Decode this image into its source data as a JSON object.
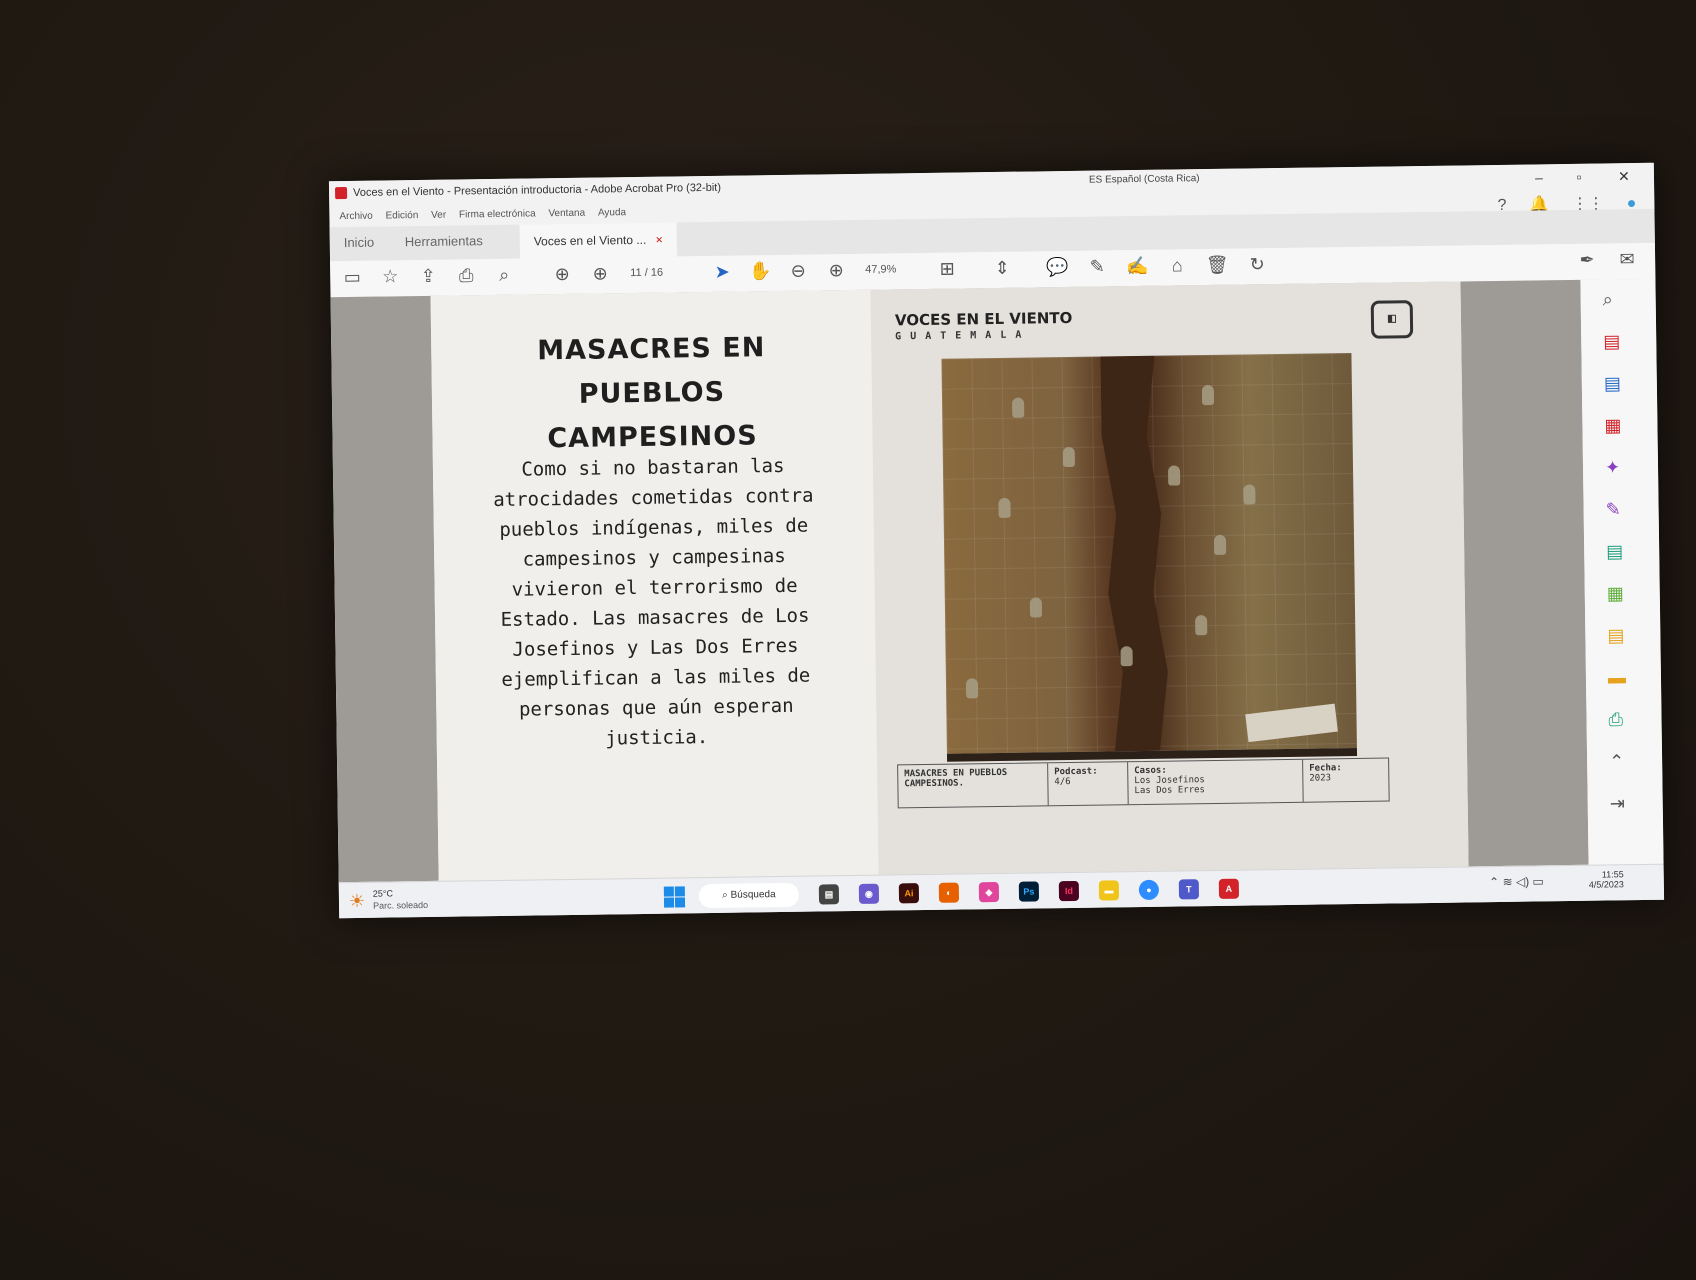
{
  "window": {
    "title": "Voces en el Viento - Presentación introductoria - Adobe Acrobat Pro (32-bit)",
    "language": "ES Español (Costa Rica)",
    "minimize": "–",
    "maximize": "▫",
    "close": "✕"
  },
  "menu": [
    "Archivo",
    "Edición",
    "Ver",
    "Firma electrónica",
    "Ventana",
    "Ayuda"
  ],
  "tabs": {
    "home": "Inicio",
    "tools": "Herramientas",
    "document": "Voces en el Viento ...",
    "document_close": "×"
  },
  "toolbar": {
    "page_current": "11",
    "page_total": "/ 16",
    "zoom": "47,9%"
  },
  "slide": {
    "title_line1": "MASACRES EN PUEBLOS",
    "title_line2": "CAMPESINOS",
    "body": "Como si no bastaran las atrocidades cometidas contra pueblos indígenas, miles de campesinos y campesinas vivieron el terrorismo de Estado. Las masacres de Los Josefinos y Las Dos Erres ejemplifican a las miles de personas que aún esperan justicia.",
    "brand": "VOCES EN EL VIENTO",
    "brand_sub": "GUATEMALA",
    "meta": {
      "name": "MASACRES EN PUEBLOS CAMPESINOS.",
      "podcast_label": "Podcast:",
      "podcast_value": "4/6",
      "cases_label": "Casos:",
      "cases_value1": "Los Josefinos",
      "cases_value2": "Las Dos Erres",
      "date_label": "Fecha:",
      "date_value": "2023"
    }
  },
  "taskbar": {
    "temperature": "25°C",
    "weather": "Parc. soleado",
    "search": "Búsqueda",
    "time": "11:55",
    "date": "4/5/2023"
  }
}
